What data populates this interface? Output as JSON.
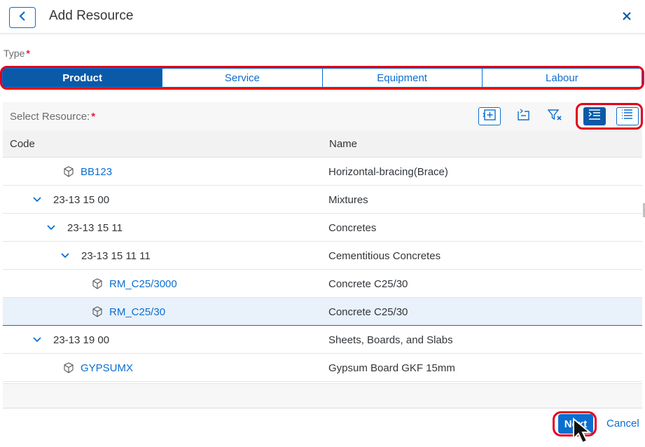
{
  "header": {
    "title": "Add Resource"
  },
  "type_field": {
    "label": "Type",
    "required_marker": "*",
    "options": [
      "Product",
      "Service",
      "Equipment",
      "Labour"
    ],
    "selected": "Product"
  },
  "resource_select": {
    "label": "Select Resource:",
    "required_marker": "*"
  },
  "table": {
    "columns": [
      "Code",
      "Name"
    ],
    "rows": [
      {
        "code": "BB123",
        "name": "Horizontal-bracing(Brace)"
      },
      {
        "code": "23-13 15 00",
        "name": "Mixtures"
      },
      {
        "code": "23-13 15 11",
        "name": "Concretes"
      },
      {
        "code": "23-13 15 11 11",
        "name": "Cementitious Concretes"
      },
      {
        "code": "RM_C25/3000",
        "name": "Concrete C25/30"
      },
      {
        "code": "RM_C25/30",
        "name": "Concrete C25/30"
      },
      {
        "code": "23-13 19 00",
        "name": "Sheets, Boards, and Slabs"
      },
      {
        "code": "GYPSUMX",
        "name": "Gypsum Board GKF 15mm"
      }
    ],
    "selected_row": "RM_C25/30"
  },
  "footer": {
    "next_label": "Next",
    "cancel_label": "Cancel"
  },
  "colors": {
    "accent": "#0a6ed1",
    "highlight_outline": "#e3001b",
    "required": "#e9193e"
  }
}
